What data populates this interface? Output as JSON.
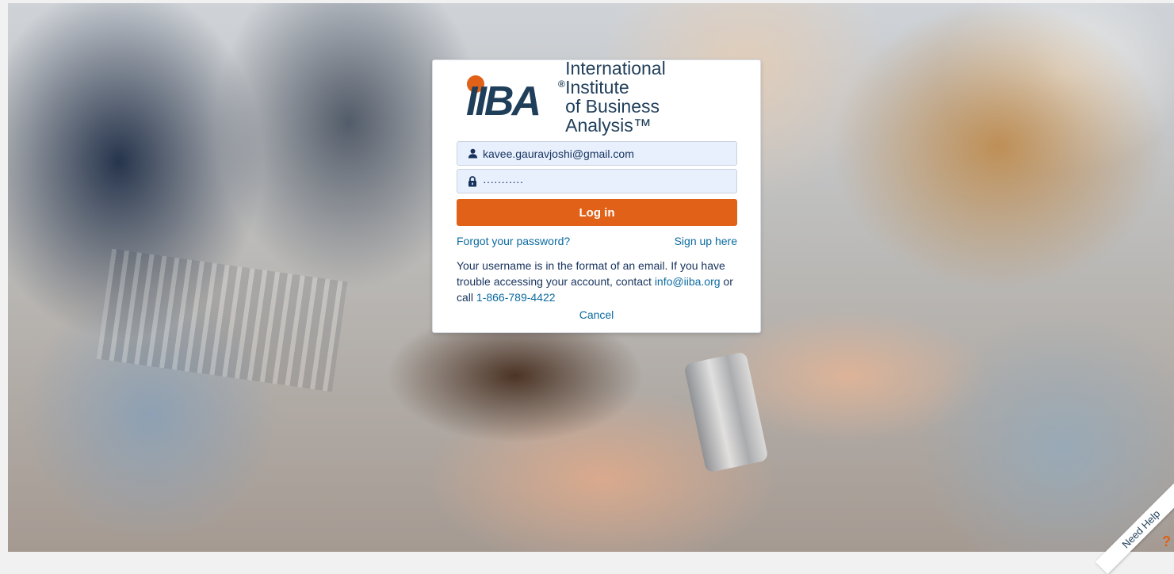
{
  "brand": {
    "logo_letters": "IIBA",
    "logo_registered": "®",
    "name_line1": "International Institute",
    "name_line2": "of Business Analysis™",
    "accent": "#e06117",
    "navy": "#1f3e5a"
  },
  "login": {
    "username_value": "kavee.gauravjoshi@gmail.com",
    "username_icon": "user-icon",
    "password_value": "···········",
    "password_icon": "lock-icon",
    "login_button": "Log in",
    "forgot_link": "Forgot your password?",
    "signup_link": "Sign up here",
    "help_text_1": "Your username is in the format of an email. If you have trouble accessing your account, contact ",
    "help_email": "info@iiba.org",
    "help_text_2": " or call ",
    "help_phone": "1-866-789-4422",
    "cancel_link": "Cancel"
  },
  "corner": {
    "need_help": "Need Help",
    "question_mark": "?"
  }
}
